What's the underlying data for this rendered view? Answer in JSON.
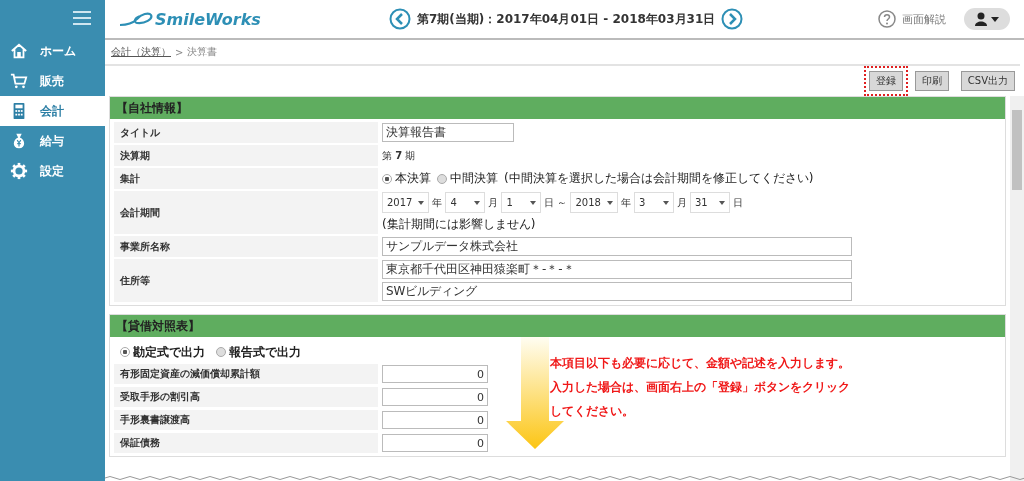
{
  "sidebar": {
    "items": [
      {
        "label": "ホーム",
        "selected": false
      },
      {
        "label": "販売",
        "selected": false
      },
      {
        "label": "会計",
        "selected": true
      },
      {
        "label": "給与",
        "selected": false
      },
      {
        "label": "設定",
        "selected": false
      }
    ]
  },
  "header": {
    "logo": "SmileWorks",
    "period": "第7期(当期)：2017年04月01日 - 2018年03月31日",
    "help": "画面解説"
  },
  "breadcrumb": {
    "parent": "会計（決算）",
    "separator": ">",
    "current": "決算書"
  },
  "toolbar": {
    "buttons": [
      {
        "label": "登録",
        "highlighted": true
      },
      {
        "label": "印刷",
        "highlighted": false
      },
      {
        "label": "CSV出力",
        "highlighted": false
      }
    ]
  },
  "company_info": {
    "title": "【自社情報】",
    "rows": [
      {
        "kind": "input",
        "label": "タイトル",
        "value": "決算報告書"
      },
      {
        "kind": "text",
        "label": "決算期",
        "value": "第 **7** 期"
      },
      {
        "kind": "radio",
        "label": "集計",
        "options": [
          {
            "label": "本決算",
            "selected": true
          },
          {
            "label": "中間決算",
            "selected": false
          }
        ],
        "note": "(中間決算を選択した場合は会計期間を修正してください)"
      },
      {
        "kind": "dates",
        "label": "会計期間",
        "parts": [
          {
            "kind": "select",
            "value": "2017"
          },
          {
            "kind": "text",
            "value": "年"
          },
          {
            "kind": "select",
            "value": "4"
          },
          {
            "kind": "text",
            "value": "月"
          },
          {
            "kind": "select",
            "value": "1"
          },
          {
            "kind": "text",
            "value": "日"
          },
          {
            "kind": "text",
            "value": "～"
          },
          {
            "kind": "select",
            "value": "2018"
          },
          {
            "kind": "text",
            "value": "年"
          },
          {
            "kind": "select",
            "value": "3"
          },
          {
            "kind": "text",
            "value": "月"
          },
          {
            "kind": "select",
            "value": "31"
          },
          {
            "kind": "text",
            "value": "日"
          }
        ],
        "note": "(集計期間には影響しません)"
      },
      {
        "kind": "input",
        "label": "事業所名称",
        "value": "サンプルデータ株式会社"
      },
      {
        "kind": "inputs",
        "label": "住所等",
        "values": [
          "東京都千代田区神田猿楽町＊-＊-＊",
          "SWビルディング"
        ]
      }
    ]
  },
  "balance_sheet": {
    "title": "【貸借対照表】",
    "options": [
      {
        "label": "勘定式で出力",
        "selected": true
      },
      {
        "label": "報告式で出力",
        "selected": false
      }
    ],
    "rows": [
      {
        "label": "有形固定資産の減価償却累計額",
        "value": "0"
      },
      {
        "label": "受取手形の割引高",
        "value": "0"
      },
      {
        "label": "手形裏書譲渡高",
        "value": "0"
      },
      {
        "label": "保証債務",
        "value": "0"
      }
    ],
    "note_lines": [
      "本項目以下も必要に応じて、金額や記述を入力します。",
      "入力した場合は、画面右上の「登録」ボタンをクリック",
      "してください。"
    ]
  }
}
